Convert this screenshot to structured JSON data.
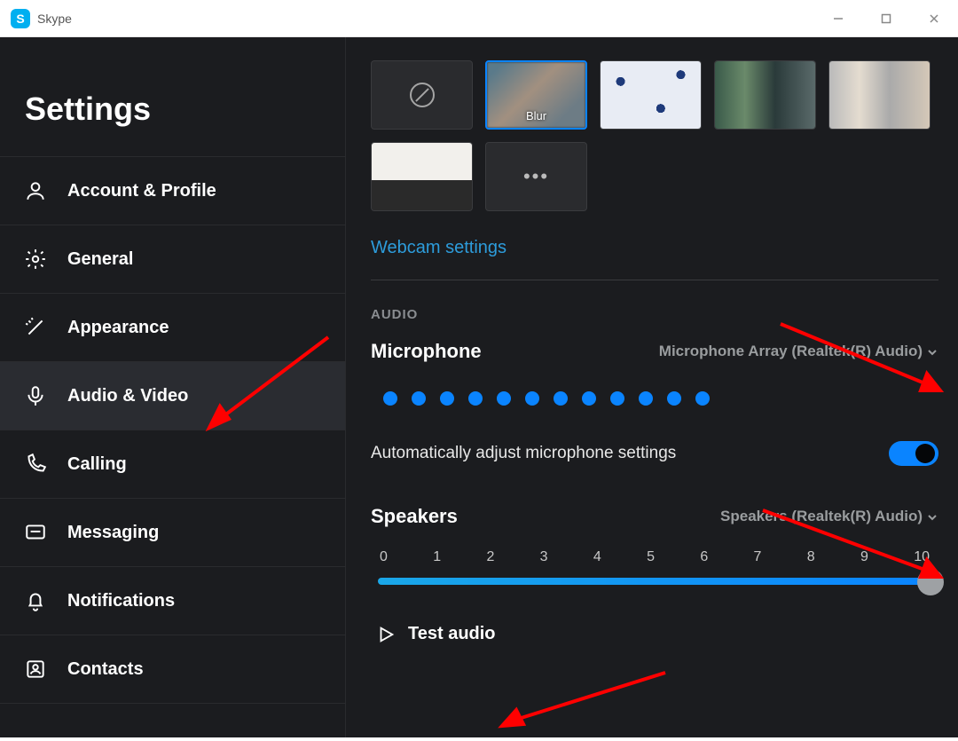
{
  "app": {
    "name": "Skype"
  },
  "sidebar": {
    "title": "Settings",
    "items": [
      {
        "label": "Account & Profile"
      },
      {
        "label": "General"
      },
      {
        "label": "Appearance"
      },
      {
        "label": "Audio & Video"
      },
      {
        "label": "Calling"
      },
      {
        "label": "Messaging"
      },
      {
        "label": "Notifications"
      },
      {
        "label": "Contacts"
      }
    ]
  },
  "backgrounds": {
    "blur_label": "Blur"
  },
  "webcam_link": "Webcam settings",
  "audio": {
    "section_title": "AUDIO",
    "mic_label": "Microphone",
    "mic_device": "Microphone Array (Realtek(R) Audio)",
    "auto_adjust": "Automatically adjust microphone settings",
    "speakers_label": "Speakers",
    "speakers_device": "Speakers (Realtek(R) Audio)",
    "ticks": [
      "0",
      "1",
      "2",
      "3",
      "4",
      "5",
      "6",
      "7",
      "8",
      "9",
      "10"
    ],
    "test_label": "Test audio"
  }
}
